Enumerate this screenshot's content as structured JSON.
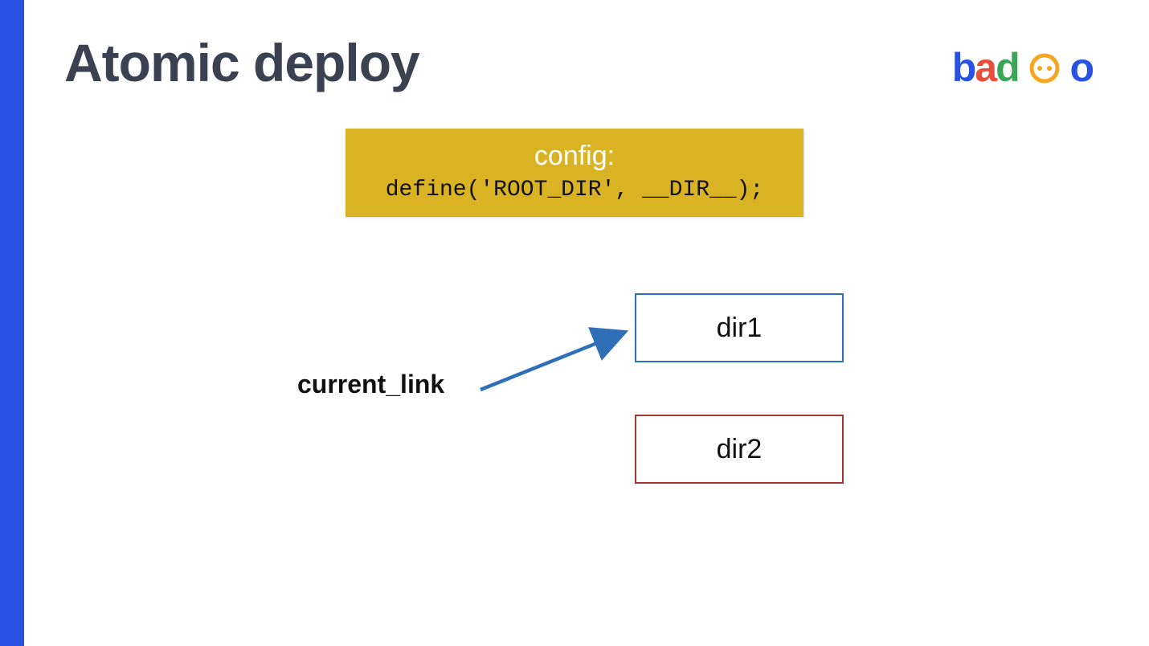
{
  "title": "Atomic deploy",
  "logo": {
    "b": "b",
    "a": "a",
    "d": "d",
    "o1": "O",
    "o2": "o"
  },
  "config": {
    "label": "config:",
    "code": "define('ROOT_DIR', __DIR__);"
  },
  "current_link": "current_link",
  "dirs": {
    "dir1": "dir1",
    "dir2": "dir2"
  }
}
